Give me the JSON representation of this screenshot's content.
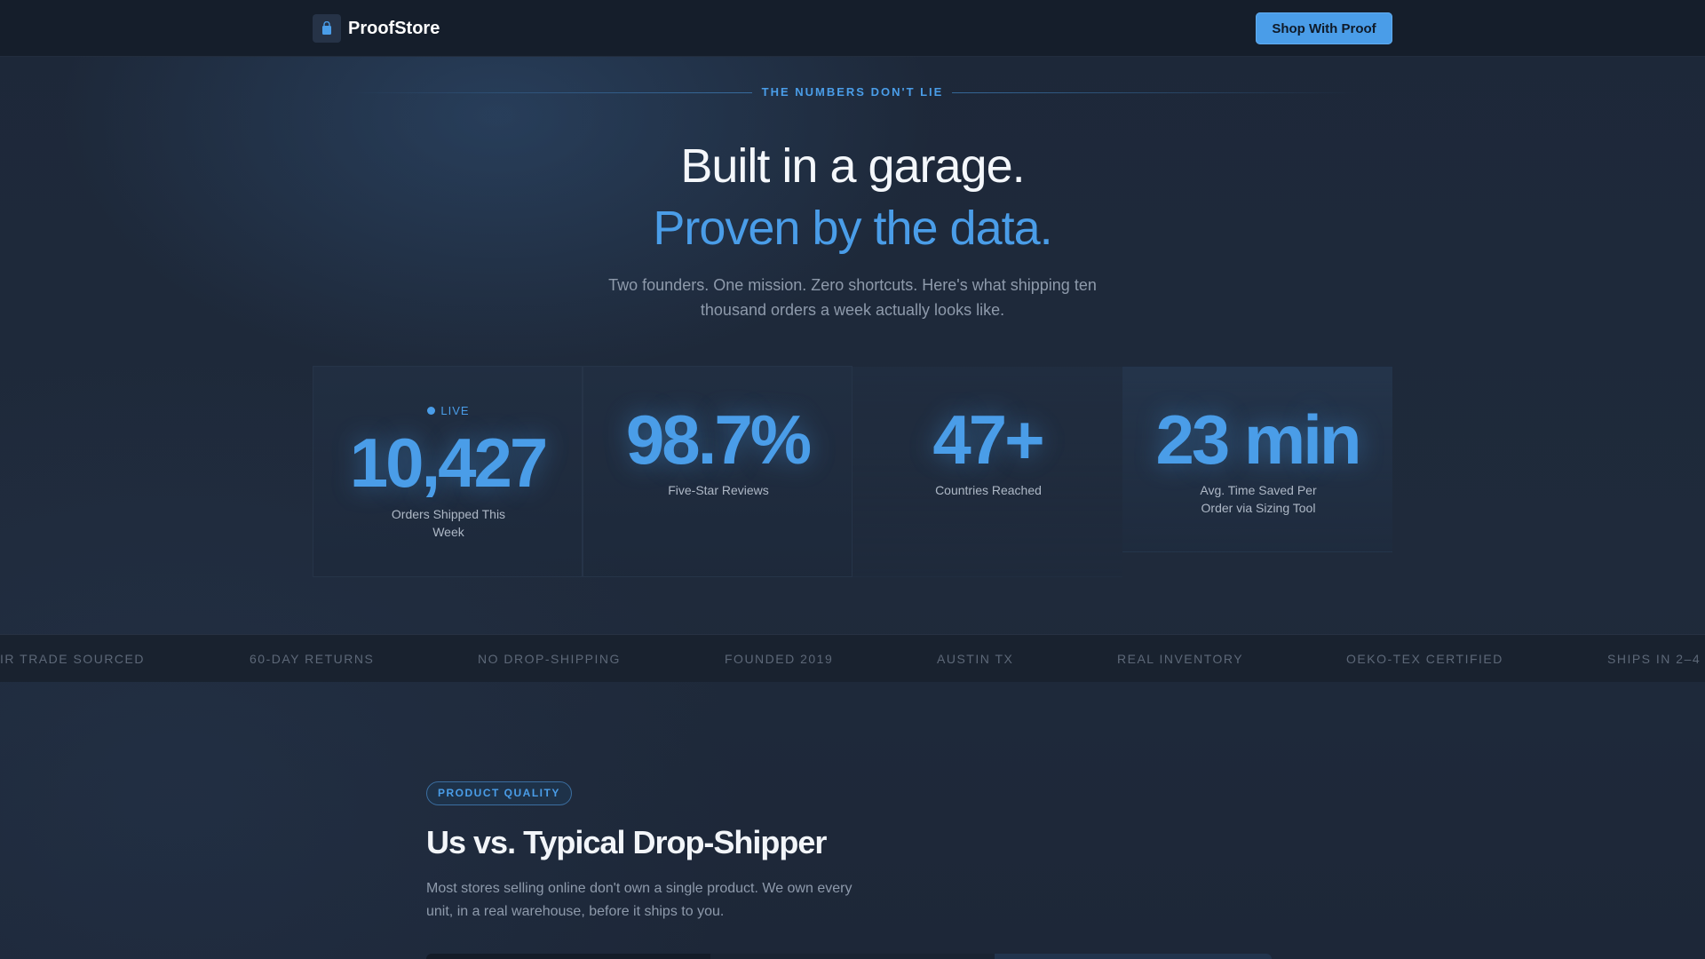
{
  "nav": {
    "brand": "ProofStore",
    "logo_icon": "shopping-bag-icon",
    "cta_label": "Shop With Proof"
  },
  "hero": {
    "eyebrow": "THE NUMBERS DON'T LIE",
    "title": "Built in a garage.",
    "title_accent": "Proven by the data.",
    "subtitle": "Two founders. One mission. Zero shortcuts. Here's what shipping ten thousand orders a week actually looks like."
  },
  "stats": [
    {
      "live_label": "LIVE",
      "value": "10,427",
      "label": "Orders Shipped This Week"
    },
    {
      "value": "98.7%",
      "label": "Five-Star Reviews"
    },
    {
      "value": "47+",
      "label": "Countries Reached"
    },
    {
      "value": "23 min",
      "label": "Avg. Time Saved Per Order via Sizing Tool"
    }
  ],
  "marquee": [
    "IR TRADE SOURCED",
    "60-DAY RETURNS",
    "NO DROP-SHIPPING",
    "FOUNDED 2019",
    "AUSTIN TX",
    "REAL INVENTORY",
    "OEKO-TEX CERTIFIED",
    "SHIPS IN 2–4"
  ],
  "quality": {
    "badge": "PRODUCT QUALITY",
    "title": "Us vs. Typical Drop-Shipper",
    "subtitle": "Most stores selling online don't own a single product. We own every unit, in a real warehouse, before it ships to you."
  },
  "colors": {
    "accent": "#4a9de8",
    "background": "#1c2636",
    "nav_background": "#151e2b",
    "muted_text": "#8e9aab"
  }
}
